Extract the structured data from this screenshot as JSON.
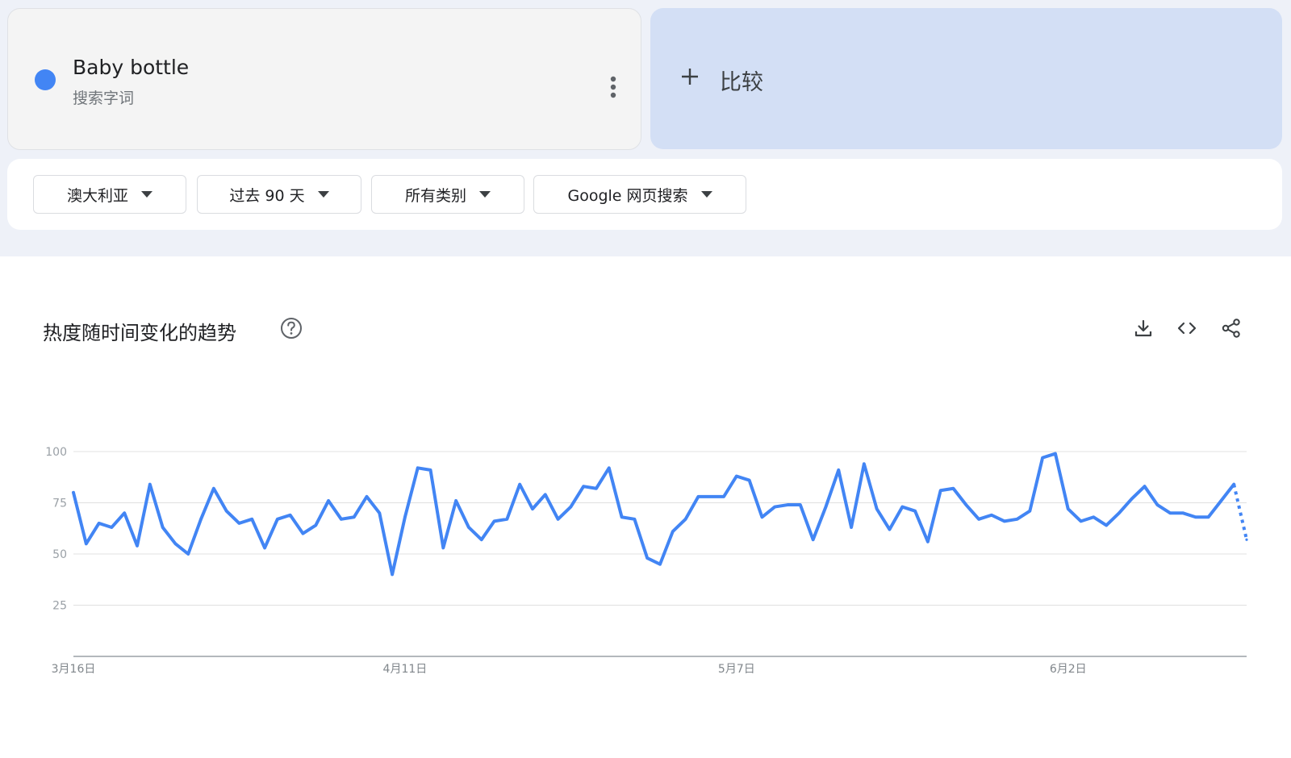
{
  "colors": {
    "series": "#4285f4",
    "compare_bg": "#d3dff5",
    "band_bg": "#eef1f8"
  },
  "term": {
    "name": "Baby bottle",
    "type": "搜索字词",
    "menu_icon": "more-vert-icon"
  },
  "compare": {
    "icon": "plus-icon",
    "label": "比较"
  },
  "filters": {
    "region": "澳大利亚",
    "time_range": "过去 90 天",
    "category": "所有类别",
    "search_type": "Google 网页搜索"
  },
  "chart_card": {
    "title": "热度随时间变化的趋势",
    "help_icon": "help-icon",
    "tools": [
      "download-icon",
      "embed-code-icon",
      "share-icon"
    ]
  },
  "chart_data": {
    "type": "line",
    "title": "热度随时间变化的趋势",
    "xlabel": "",
    "ylabel": "",
    "ylim": [
      0,
      100
    ],
    "yticks": [
      25,
      50,
      75,
      100
    ],
    "grid": true,
    "legend": "none",
    "xtick_labels": [
      {
        "index": 0,
        "label": "3月16日"
      },
      {
        "index": 26,
        "label": "4月11日"
      },
      {
        "index": 52,
        "label": "5月7日"
      },
      {
        "index": 78,
        "label": "6月2日"
      }
    ],
    "series": [
      {
        "values": [
          80,
          55,
          65,
          63,
          70,
          54,
          84,
          63,
          55,
          50,
          67,
          82,
          71,
          65,
          67,
          53,
          67,
          69,
          60,
          64,
          76,
          67,
          68,
          78,
          70,
          40,
          68,
          92,
          91,
          53,
          76,
          63,
          57,
          66,
          67,
          84,
          72,
          79,
          67,
          73,
          83,
          82,
          92,
          68,
          67,
          48,
          45,
          61,
          67,
          78,
          78,
          78,
          88,
          86,
          68,
          73,
          74,
          74,
          57,
          73,
          91,
          63,
          94,
          72,
          62,
          73,
          71,
          56,
          81,
          82,
          74,
          67,
          69,
          66,
          67,
          71,
          97,
          99,
          72,
          66,
          68,
          64,
          70,
          77,
          83,
          74,
          70,
          70,
          68,
          68,
          76,
          84,
          57
        ],
        "partial_last_point": true
      }
    ]
  }
}
